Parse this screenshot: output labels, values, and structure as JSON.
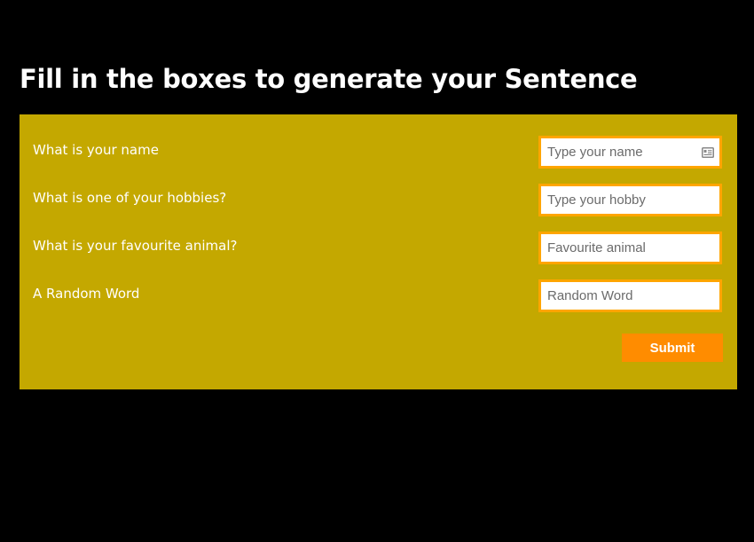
{
  "page": {
    "title": "Fill in the boxes to generate your Sentence"
  },
  "form": {
    "fields": [
      {
        "label": "What is your name",
        "placeholder": "Type your name",
        "value": "",
        "icon": "contact-card-icon"
      },
      {
        "label": "What is one of your hobbies?",
        "placeholder": "Type your hobby",
        "value": ""
      },
      {
        "label": "What is your favourite animal?",
        "placeholder": "Favourite animal",
        "value": ""
      },
      {
        "label": "A Random Word",
        "placeholder": "Random Word",
        "value": ""
      }
    ],
    "submit_label": "Submit"
  },
  "colors": {
    "background": "#000000",
    "panel": "#c4a800",
    "field_border": "#ffa500",
    "button": "#ff8c00",
    "text": "#ffffff"
  }
}
